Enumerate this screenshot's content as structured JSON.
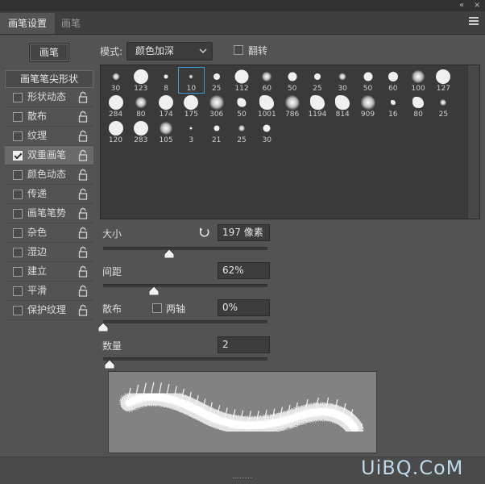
{
  "window_controls": {
    "collapse_label": "«",
    "close_label": "×"
  },
  "tabs": [
    {
      "label": "画笔设置",
      "active": true
    },
    {
      "label": "画笔",
      "active": false
    }
  ],
  "brush_button_label": "画笔",
  "left_panel": {
    "tip_shape_label": "画笔笔尖形状",
    "options": [
      {
        "label": "形状动态",
        "checked": false
      },
      {
        "label": "散布",
        "checked": false
      },
      {
        "label": "纹理",
        "checked": false
      },
      {
        "label": "双重画笔",
        "checked": true,
        "selected": true
      },
      {
        "label": "颜色动态",
        "checked": false
      },
      {
        "label": "传递",
        "checked": false
      },
      {
        "label": "画笔笔势",
        "checked": false
      },
      {
        "label": "杂色",
        "checked": false
      },
      {
        "label": "湿边",
        "checked": false
      },
      {
        "label": "建立",
        "checked": false
      },
      {
        "label": "平滑",
        "checked": false
      },
      {
        "label": "保护纹理",
        "checked": false
      }
    ]
  },
  "mode": {
    "label": "模式:",
    "value": "颜色加深"
  },
  "flip": {
    "label": "翻转",
    "checked": false
  },
  "brush_tips": [
    "30",
    "123",
    "8",
    "10",
    "25",
    "112",
    "60",
    "50",
    "25",
    "30",
    "50",
    "60",
    "100",
    "127",
    "284",
    "80",
    "174",
    "175",
    "306",
    "50",
    "1001",
    "786",
    "1194",
    "814",
    "909",
    "16",
    "80",
    "25",
    "120",
    "283",
    "105",
    "3",
    "21",
    "25",
    "30"
  ],
  "selected_tip_index": 3,
  "size": {
    "label": "大小",
    "value": "197 像素",
    "slider_fraction": 0.4
  },
  "spacing": {
    "label": "间距",
    "value": "62%",
    "slider_fraction": 0.31
  },
  "scatter": {
    "label": "散布",
    "both_axes_label": "两轴",
    "both_axes_checked": false,
    "value": "0%",
    "slider_fraction": 0.0
  },
  "count": {
    "label": "数量",
    "value": "2",
    "slider_fraction": 0.04
  },
  "watermark": "UiBQ.CoM",
  "colors": {
    "panel": "#535353",
    "selection_outline": "#3b9bd6",
    "preview_bg": "#828282"
  }
}
